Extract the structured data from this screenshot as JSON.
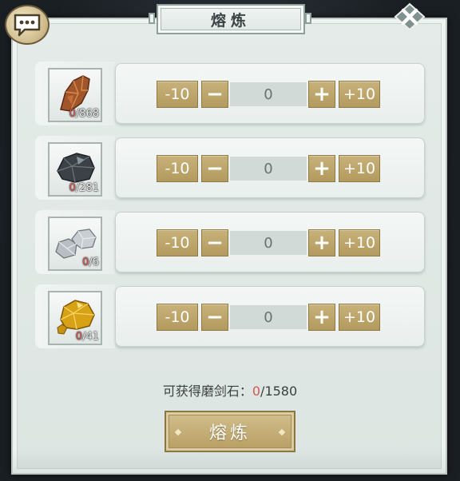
{
  "title": "熔炼",
  "materials": [
    {
      "name": "copper-ore",
      "owned": "0",
      "total": "/868",
      "minus10": "-10",
      "minus": "−",
      "qty": "0",
      "plus": "+",
      "plus10": "+10"
    },
    {
      "name": "iron-ore",
      "owned": "0",
      "total": "/281",
      "minus10": "-10",
      "minus": "−",
      "qty": "0",
      "plus": "+",
      "plus10": "+10"
    },
    {
      "name": "silver-ore",
      "owned": "0",
      "total": "/6",
      "minus10": "-10",
      "minus": "−",
      "qty": "0",
      "plus": "+",
      "plus10": "+10"
    },
    {
      "name": "gold-ore",
      "owned": "0",
      "total": "/41",
      "minus10": "-10",
      "minus": "−",
      "qty": "0",
      "plus": "+",
      "plus10": "+10"
    }
  ],
  "summary": {
    "label": "可获得磨剑石：",
    "value": "0",
    "max": "/1580"
  },
  "action_button": "熔炼",
  "icons": {
    "chat": "chat-bubble-icon",
    "close": "close-icon"
  },
  "colors": {
    "accent_gold": "#b39a5e",
    "panel": "#e4ebe8",
    "warning_red": "#d9534f"
  }
}
